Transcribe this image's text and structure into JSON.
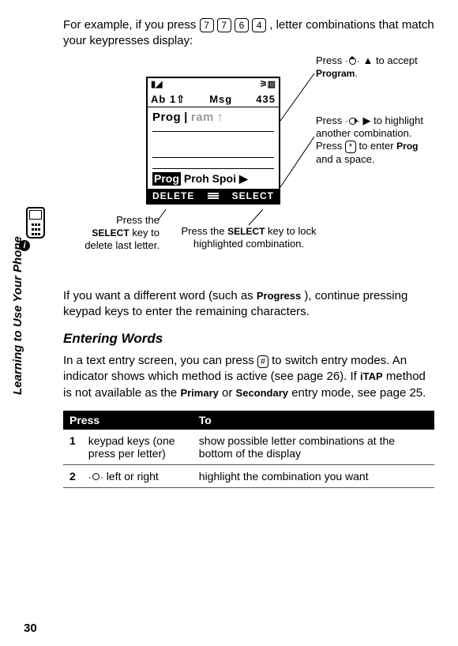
{
  "sidebar_label": "Learning to Use Your Phone",
  "page_number": "30",
  "intro": {
    "before_keys": "For example, if you press ",
    "keys": [
      "7",
      "7",
      "6",
      "4"
    ],
    "after_keys": ", letter combinations that match your keypresses display:"
  },
  "screen": {
    "mode_indicator": "Ab 1⇧",
    "title": "Msg",
    "counter": "435",
    "prediction_prefix": "Prog",
    "prediction_cursor": "|",
    "prediction_suffix": "ram",
    "prediction_arrow": "↑",
    "suggestion_hl": "Prog",
    "suggestion_rest": "Proh Spoi",
    "suggestion_arrow": "▶",
    "soft_left": "DELETE",
    "soft_right": "SELECT"
  },
  "callouts": {
    "up": {
      "pre": "Press ",
      "post": " to accept ",
      "word": "Program",
      "dot": "."
    },
    "right": {
      "pre": "Press ",
      "mid1": " to highlight another combination. Press ",
      "mid2": " to enter ",
      "word": "Prog",
      "post": " and a space."
    },
    "star_key": "*",
    "delete": {
      "pre": "Press the ",
      "key": "SELECT",
      "post": " key to delete last letter."
    },
    "lock": {
      "pre": "Press the ",
      "key": "SELECT",
      "post": " key to lock highlighted combination."
    }
  },
  "para2": {
    "pre": "If you want a different word (such as ",
    "word": "Progress",
    "post": "), continue pressing keypad keys to enter the remaining characters."
  },
  "heading": "Entering Words",
  "para3": {
    "pre": "In a text entry screen, you can press ",
    "key": "#",
    "mid": " to switch entry modes. An indicator shows which method is active (see page 26). If ",
    "itap": "iTAP",
    "mid2": " method is not available as the ",
    "primary": "Primary",
    "or": " or ",
    "secondary": "Secondary",
    "post": " entry mode, see page 25."
  },
  "table": {
    "head_press": "Press",
    "head_to": "To",
    "rows": [
      {
        "n": "1",
        "press": "keypad keys (one press per letter)",
        "to": "show possible letter combinations at the bottom of the display"
      },
      {
        "n": "2",
        "press_suffix": " left or right",
        "to": "highlight the combination you want"
      }
    ]
  }
}
